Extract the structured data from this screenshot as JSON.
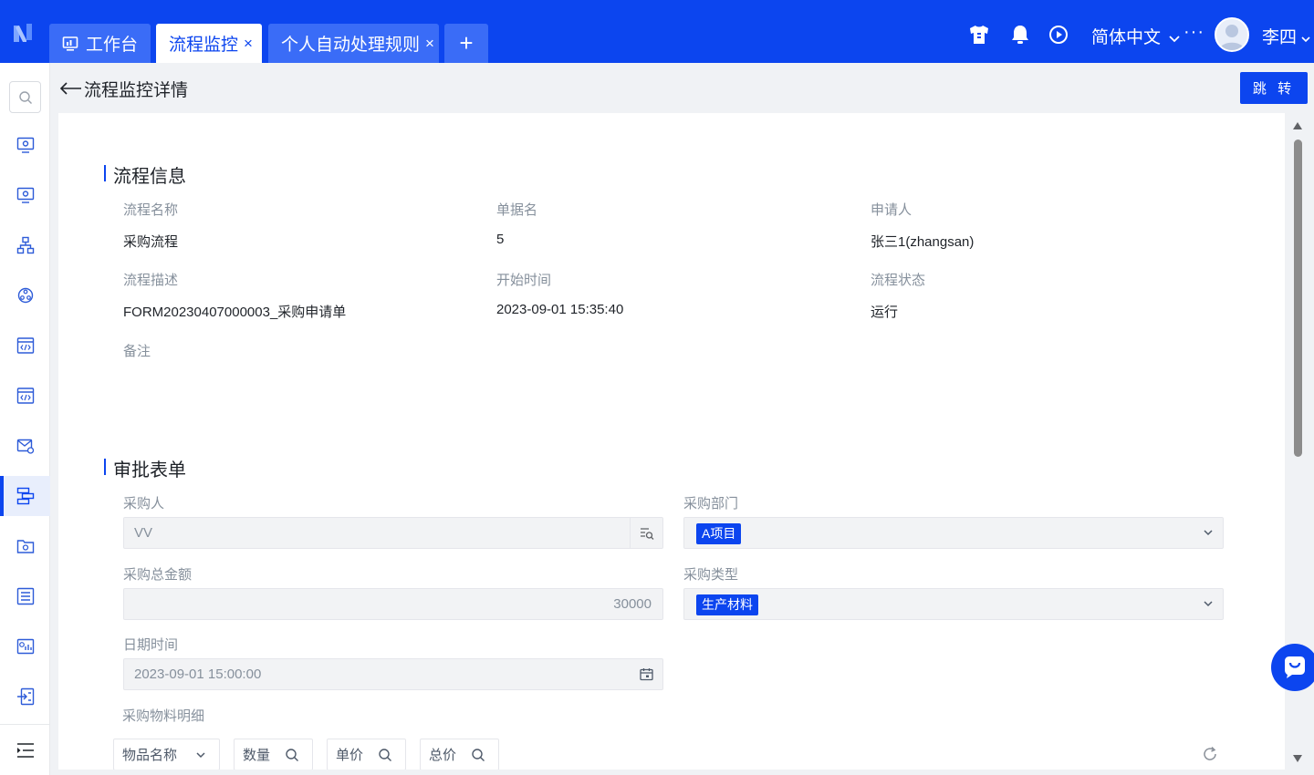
{
  "topbar": {
    "tabs": [
      {
        "label": "工作台",
        "closable": false
      },
      {
        "label": "流程监控",
        "closable": true,
        "active": true
      },
      {
        "label": "个人自动处理规则",
        "closable": true
      }
    ],
    "close_glyph": "×",
    "add_glyph": "+",
    "icons": [
      "shirt-icon",
      "bell-icon",
      "play-circle-icon"
    ],
    "language": "简体中文",
    "more_glyph": "···",
    "username": "李四"
  },
  "sidebar": {
    "items": [
      "monitor-gear-icon",
      "monitor-gear-icon",
      "org-chart-icon",
      "cloud-network-icon",
      "code-window-icon",
      "code-window-icon",
      "mail-settings-icon",
      "flow-list-icon",
      "folder-settings-icon",
      "list-settings-icon",
      "chart-settings-icon",
      "import-icon"
    ],
    "active_index": 7,
    "bottom_icon": "menu-collapse-icon"
  },
  "header": {
    "title": "流程监控详情",
    "jump_button": "跳 转"
  },
  "process_info": {
    "title": "流程信息",
    "fields": [
      {
        "label": "流程名称",
        "value": "采购流程"
      },
      {
        "label": "单据名",
        "value": "5"
      },
      {
        "label": "申请人",
        "value": "张三1(zhangsan)"
      },
      {
        "label": "流程描述",
        "value": "FORM20230407000003_采购申请单"
      },
      {
        "label": "开始时间",
        "value": "2023-09-01 15:35:40"
      },
      {
        "label": "流程状态",
        "value": "运行"
      },
      {
        "label": "备注",
        "value": ""
      }
    ]
  },
  "approval_form": {
    "title": "审批表单",
    "purchaser": {
      "label": "采购人",
      "value": "VV"
    },
    "department": {
      "label": "采购部门",
      "value": "A项目"
    },
    "total_amount": {
      "label": "采购总金额",
      "value": "30000"
    },
    "purchase_type": {
      "label": "采购类型",
      "value": "生产材料"
    },
    "datetime": {
      "label": "日期时间",
      "value": "2023-09-01 15:00:00"
    },
    "detail_label": "采购物料明细",
    "columns": [
      "物品名称",
      "数量",
      "单价",
      "总价"
    ]
  },
  "colors": {
    "primary": "#0c45ef",
    "tab_inactive": "#3a6cf7",
    "label_gray": "#86909c",
    "field_bg": "#f2f3f5"
  }
}
